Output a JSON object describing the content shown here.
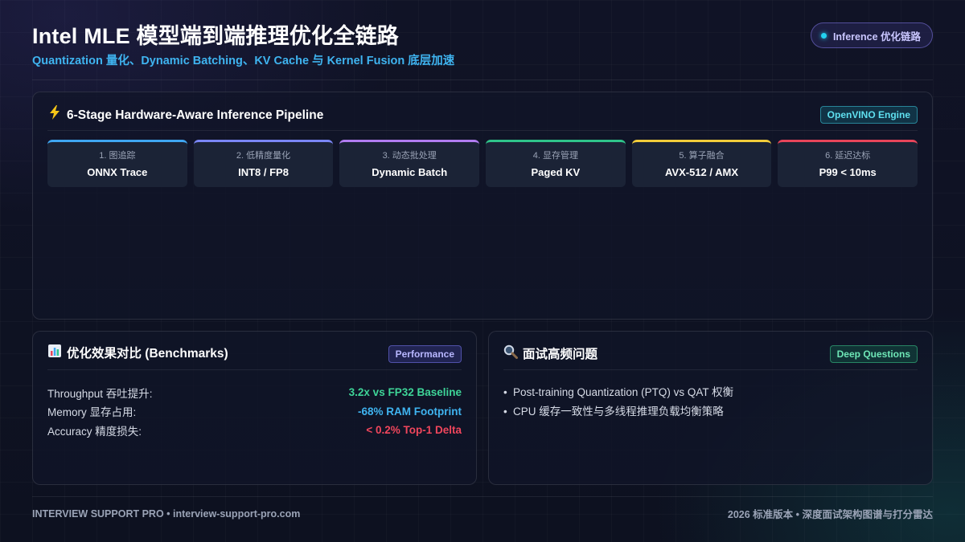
{
  "header": {
    "title": "Intel MLE 模型端到端推理优化全链路",
    "subtitle": "Quantization 量化、Dynamic Batching、KV Cache 与 Kernel Fusion 底层加速",
    "pill_label": "Inference 优化链路"
  },
  "pipeline": {
    "icon": "lightning-icon",
    "title": "6-Stage Hardware-Aware Inference Pipeline",
    "tag": "OpenVINO Engine",
    "stages": [
      {
        "step": "1. 图追踪",
        "tech": "ONNX Trace",
        "color": "#3fa6f2"
      },
      {
        "step": "2. 低精度量化",
        "tech": "INT8 / FP8",
        "color": "#7a86f5"
      },
      {
        "step": "3. 动态批处理",
        "tech": "Dynamic Batch",
        "color": "#b17cf0"
      },
      {
        "step": "4. 显存管理",
        "tech": "Paged KV",
        "color": "#2fc48a"
      },
      {
        "step": "5. 算子融合",
        "tech": "AVX-512 / AMX",
        "color": "#f2cc3a"
      },
      {
        "step": "6. 延迟达标",
        "tech": "P99 < 10ms",
        "color": "#e8455a"
      }
    ]
  },
  "benchmarks": {
    "icon": "bar-chart-icon",
    "title": "优化效果对比 (Benchmarks)",
    "tag": "Performance",
    "rows": [
      {
        "label": "Throughput 吞吐提升:",
        "value": "3.2x vs FP32 Baseline",
        "color": "#3ed598"
      },
      {
        "label": "Memory 显存占用:",
        "value": "-68% RAM Footprint",
        "color": "#3fb4f0"
      },
      {
        "label": "Accuracy 精度损失:",
        "value": "< 0.2% Top-1 Delta",
        "color": "#f0465c"
      }
    ]
  },
  "questions": {
    "icon": "magnifier-icon",
    "title": "面试高频问题",
    "tag": "Deep Questions",
    "items": [
      "Post-training Quantization (PTQ) vs QAT 权衡",
      "CPU 缓存一致性与多线程推理负载均衡策略"
    ]
  },
  "footer": {
    "left": "INTERVIEW SUPPORT PRO • interview-support-pro.com",
    "right": "2026 标准版本 • 深度面试架构图谱与打分雷达"
  }
}
